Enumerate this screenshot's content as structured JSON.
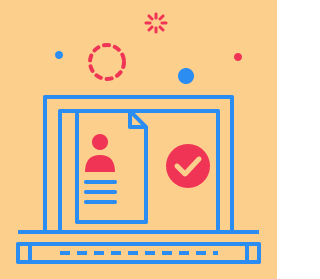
{
  "illustration": {
    "subject": "laptop-with-document-and-checkmark",
    "icons": [
      "sparkle-icon",
      "dot-icon",
      "dashed-circle-icon",
      "laptop-icon",
      "document-icon",
      "person-icon",
      "checkmark-badge-icon"
    ]
  },
  "colors": {
    "background": "#FCD08C",
    "outline": "#2B8CF2",
    "accent": "#EF3456"
  }
}
